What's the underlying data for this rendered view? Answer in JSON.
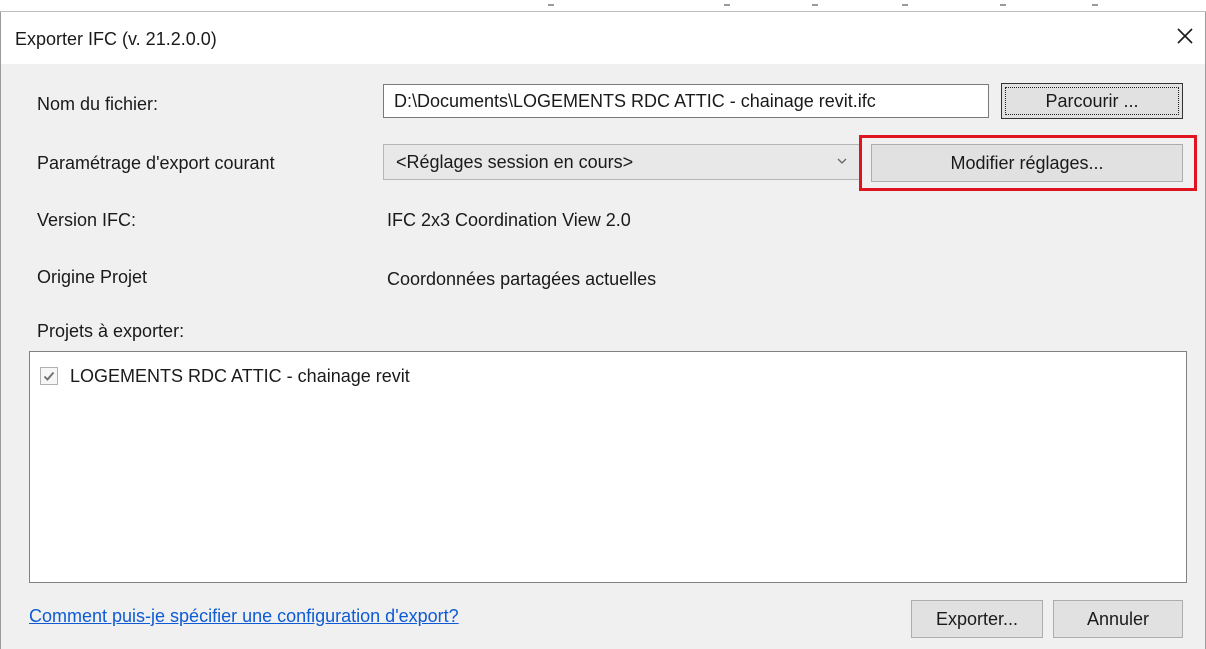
{
  "window": {
    "title": "Exporter IFC (v. 21.2.0.0)"
  },
  "form": {
    "filename_label": "Nom du fichier:",
    "filename_value": "D:\\Documents\\LOGEMENTS RDC ATTIC - chainage revit.ifc",
    "browse_label": "Parcourir ...",
    "setup_label": "Paramétrage d'export courant",
    "setup_selected": "<Réglages session en cours>",
    "modify_label": "Modifier réglages...",
    "version_label": "Version IFC:",
    "version_value": "IFC 2x3 Coordination View 2.0",
    "origin_label": "Origine Projet",
    "origin_value": "Coordonnées partagées actuelles",
    "projects_label": "Projets à exporter:"
  },
  "projects": [
    {
      "name": "LOGEMENTS RDC ATTIC - chainage revit",
      "checked": true
    }
  ],
  "footer": {
    "help_link": "Comment puis-je spécifier une configuration d'export?",
    "export_label": "Exporter...",
    "cancel_label": "Annuler"
  },
  "colors": {
    "highlight": "#e0141e",
    "link": "#0e5bd4"
  },
  "icons": {
    "close": "close-icon",
    "dropdown": "chevron-down-icon",
    "check": "check-icon"
  }
}
